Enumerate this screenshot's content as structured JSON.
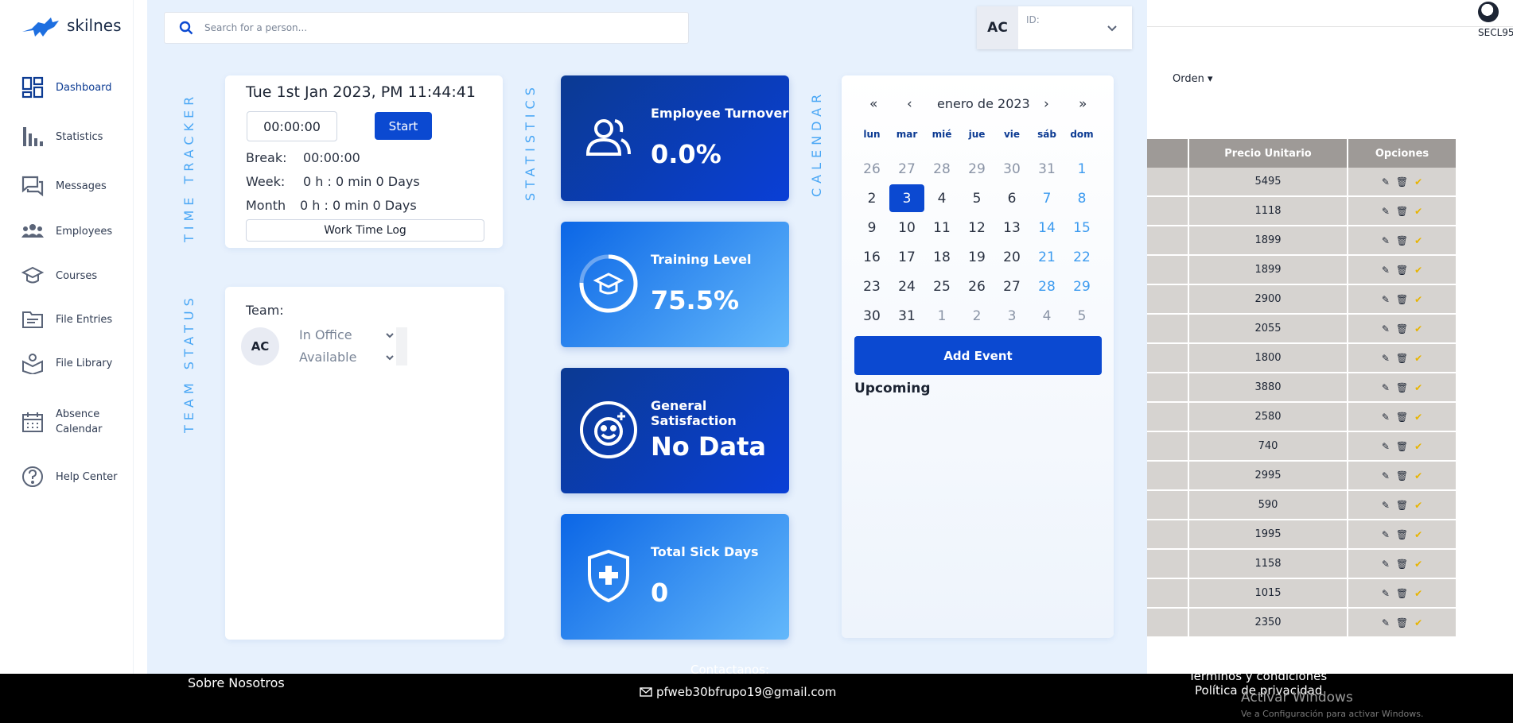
{
  "brand": {
    "name": "skilnes"
  },
  "sidebar": {
    "items": [
      {
        "label": "Dashboard"
      },
      {
        "label": "Statistics"
      },
      {
        "label": "Messages"
      },
      {
        "label": "Employees"
      },
      {
        "label": "Courses"
      },
      {
        "label": "File Entries"
      },
      {
        "label": "File Library"
      },
      {
        "label": "Absence Calendar"
      },
      {
        "label": "Help Center"
      }
    ]
  },
  "header": {
    "search_placeholder": "Search for a person...",
    "user_initials": "AC",
    "user_id_label": "ID:"
  },
  "sections": {
    "time_tracker": "TIME TRACKER",
    "team_status": "TEAM STATUS",
    "statistics": "STATISTICS",
    "calendar": "CALENDAR"
  },
  "time_tracker": {
    "datetime": "Tue 1st Jan 2023, PM 11:44:41",
    "timer": "00:00:00",
    "start_label": "Start",
    "break_label": "Break:",
    "break_value": "00:00:00",
    "week_label": "Week:",
    "week_value": "0 h : 0 min 0 Days",
    "month_label": "Month",
    "month_value": "0 h : 0 min 0 Days",
    "log_label": "Work Time Log"
  },
  "team": {
    "label": "Team:",
    "member_initials": "AC",
    "location": "In Office",
    "availability": "Available"
  },
  "stats": [
    {
      "title": "Employee Turnover",
      "value": "0.0%",
      "icon": "users-icon"
    },
    {
      "title": "Training Level",
      "value": "75.5%",
      "icon": "graduation-cap-icon"
    },
    {
      "title": "General Satisfaction",
      "value": "No Data",
      "icon": "smiley-icon"
    },
    {
      "title": "Total Sick Days",
      "value": "0",
      "icon": "medical-shield-icon"
    }
  ],
  "calendar": {
    "month_label": "enero de 2023",
    "prev_year": "«",
    "prev_month": "‹",
    "next_month": "›",
    "next_year": "»",
    "weekdays": [
      "lun",
      "mar",
      "mié",
      "jue",
      "vie",
      "sáb",
      "dom"
    ],
    "weeks": [
      [
        "26",
        "27",
        "28",
        "29",
        "30",
        "31",
        "1"
      ],
      [
        "2",
        "3",
        "4",
        "5",
        "6",
        "7",
        "8"
      ],
      [
        "9",
        "10",
        "11",
        "12",
        "13",
        "14",
        "15"
      ],
      [
        "16",
        "17",
        "18",
        "19",
        "20",
        "21",
        "22"
      ],
      [
        "23",
        "24",
        "25",
        "26",
        "27",
        "28",
        "29"
      ],
      [
        "30",
        "31",
        "1",
        "2",
        "3",
        "4",
        "5"
      ]
    ],
    "selected_day": "3",
    "add_event_label": "Add Event",
    "upcoming_label": "Upcoming"
  },
  "background_page": {
    "orden_label": "Orden",
    "user_name": "SECL95",
    "table_headers": [
      "",
      "Precio Unitario",
      "Opciones"
    ],
    "prices": [
      "5495",
      "1118",
      "1899",
      "1899",
      "2900",
      "2055",
      "1800",
      "3880",
      "2580",
      "740",
      "2995",
      "590",
      "1995",
      "1158",
      "1015",
      "2350"
    ]
  },
  "footer": {
    "about": "Sobre Nosotros",
    "contact": "Contactanos:",
    "email": "pfweb30bfrupo19@gmail.com",
    "terms": "Términos y condiciones",
    "privacy": "Política de privacidad",
    "windows_title": "Activar Windows",
    "windows_sub": "Ve a Configuración para activar Windows."
  },
  "colors": {
    "primary": "#0b49d1",
    "dark_card": "#0b3a92",
    "accent_light": "#4aa7f5",
    "background": "#e7f1fd"
  }
}
